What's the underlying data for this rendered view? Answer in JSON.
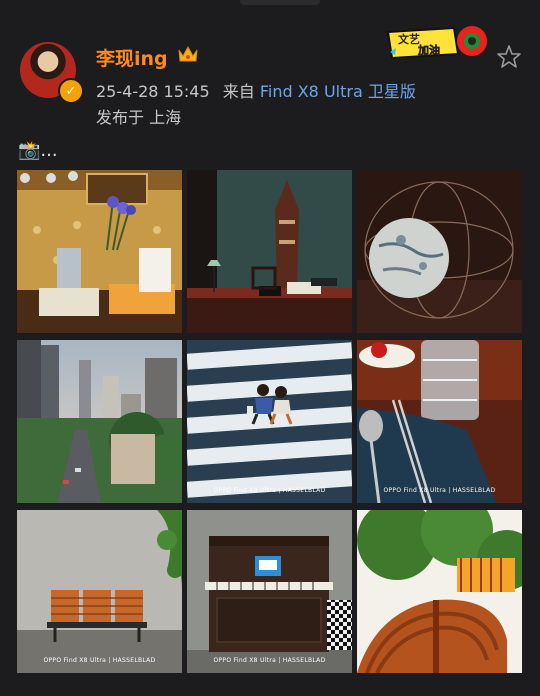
{
  "post": {
    "username": "李现ing",
    "timestamp": "25-4-28 15:45",
    "via_prefix": "来自",
    "source_device": "Find X8 Ultra 卫星版",
    "location": "发布于 上海",
    "text": "📸..."
  },
  "badge": {
    "line1": "文艺",
    "line2": "加油"
  },
  "photos": [
    {
      "subject": "reading-corner"
    },
    {
      "subject": "desk-lamp-room"
    },
    {
      "subject": "globe-sculpture"
    },
    {
      "subject": "city-street"
    },
    {
      "subject": "crosswalk-couple"
    },
    {
      "subject": "dinner-table"
    },
    {
      "subject": "orange-bench"
    },
    {
      "subject": "piano"
    },
    {
      "subject": "spiral-staircase"
    }
  ],
  "watermark": "OPPO Find X8 Ultra | HASSELBLAD",
  "colors": {
    "background": "#1c1c1e",
    "username": "#ff8a1f",
    "link": "#6ea5e8",
    "verified": "#f4a20c"
  }
}
